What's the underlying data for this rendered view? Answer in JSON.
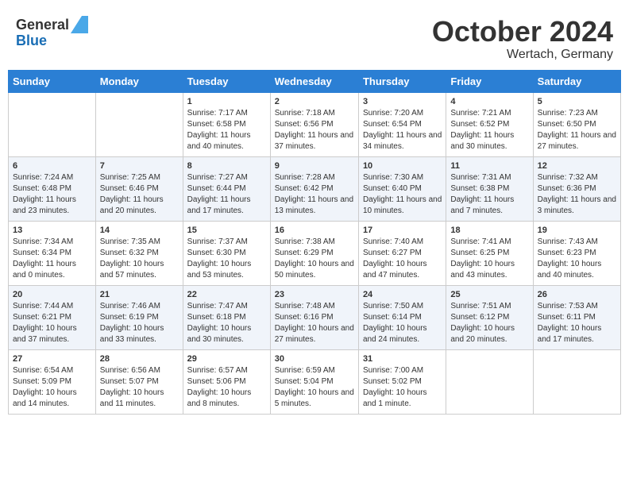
{
  "header": {
    "logo_general": "General",
    "logo_blue": "Blue",
    "month": "October 2024",
    "location": "Wertach, Germany"
  },
  "weekdays": [
    "Sunday",
    "Monday",
    "Tuesday",
    "Wednesday",
    "Thursday",
    "Friday",
    "Saturday"
  ],
  "weeks": [
    [
      {
        "day": "",
        "info": ""
      },
      {
        "day": "",
        "info": ""
      },
      {
        "day": "1",
        "info": "Sunrise: 7:17 AM\nSunset: 6:58 PM\nDaylight: 11 hours and 40 minutes."
      },
      {
        "day": "2",
        "info": "Sunrise: 7:18 AM\nSunset: 6:56 PM\nDaylight: 11 hours and 37 minutes."
      },
      {
        "day": "3",
        "info": "Sunrise: 7:20 AM\nSunset: 6:54 PM\nDaylight: 11 hours and 34 minutes."
      },
      {
        "day": "4",
        "info": "Sunrise: 7:21 AM\nSunset: 6:52 PM\nDaylight: 11 hours and 30 minutes."
      },
      {
        "day": "5",
        "info": "Sunrise: 7:23 AM\nSunset: 6:50 PM\nDaylight: 11 hours and 27 minutes."
      }
    ],
    [
      {
        "day": "6",
        "info": "Sunrise: 7:24 AM\nSunset: 6:48 PM\nDaylight: 11 hours and 23 minutes."
      },
      {
        "day": "7",
        "info": "Sunrise: 7:25 AM\nSunset: 6:46 PM\nDaylight: 11 hours and 20 minutes."
      },
      {
        "day": "8",
        "info": "Sunrise: 7:27 AM\nSunset: 6:44 PM\nDaylight: 11 hours and 17 minutes."
      },
      {
        "day": "9",
        "info": "Sunrise: 7:28 AM\nSunset: 6:42 PM\nDaylight: 11 hours and 13 minutes."
      },
      {
        "day": "10",
        "info": "Sunrise: 7:30 AM\nSunset: 6:40 PM\nDaylight: 11 hours and 10 minutes."
      },
      {
        "day": "11",
        "info": "Sunrise: 7:31 AM\nSunset: 6:38 PM\nDaylight: 11 hours and 7 minutes."
      },
      {
        "day": "12",
        "info": "Sunrise: 7:32 AM\nSunset: 6:36 PM\nDaylight: 11 hours and 3 minutes."
      }
    ],
    [
      {
        "day": "13",
        "info": "Sunrise: 7:34 AM\nSunset: 6:34 PM\nDaylight: 11 hours and 0 minutes."
      },
      {
        "day": "14",
        "info": "Sunrise: 7:35 AM\nSunset: 6:32 PM\nDaylight: 10 hours and 57 minutes."
      },
      {
        "day": "15",
        "info": "Sunrise: 7:37 AM\nSunset: 6:30 PM\nDaylight: 10 hours and 53 minutes."
      },
      {
        "day": "16",
        "info": "Sunrise: 7:38 AM\nSunset: 6:29 PM\nDaylight: 10 hours and 50 minutes."
      },
      {
        "day": "17",
        "info": "Sunrise: 7:40 AM\nSunset: 6:27 PM\nDaylight: 10 hours and 47 minutes."
      },
      {
        "day": "18",
        "info": "Sunrise: 7:41 AM\nSunset: 6:25 PM\nDaylight: 10 hours and 43 minutes."
      },
      {
        "day": "19",
        "info": "Sunrise: 7:43 AM\nSunset: 6:23 PM\nDaylight: 10 hours and 40 minutes."
      }
    ],
    [
      {
        "day": "20",
        "info": "Sunrise: 7:44 AM\nSunset: 6:21 PM\nDaylight: 10 hours and 37 minutes."
      },
      {
        "day": "21",
        "info": "Sunrise: 7:46 AM\nSunset: 6:19 PM\nDaylight: 10 hours and 33 minutes."
      },
      {
        "day": "22",
        "info": "Sunrise: 7:47 AM\nSunset: 6:18 PM\nDaylight: 10 hours and 30 minutes."
      },
      {
        "day": "23",
        "info": "Sunrise: 7:48 AM\nSunset: 6:16 PM\nDaylight: 10 hours and 27 minutes."
      },
      {
        "day": "24",
        "info": "Sunrise: 7:50 AM\nSunset: 6:14 PM\nDaylight: 10 hours and 24 minutes."
      },
      {
        "day": "25",
        "info": "Sunrise: 7:51 AM\nSunset: 6:12 PM\nDaylight: 10 hours and 20 minutes."
      },
      {
        "day": "26",
        "info": "Sunrise: 7:53 AM\nSunset: 6:11 PM\nDaylight: 10 hours and 17 minutes."
      }
    ],
    [
      {
        "day": "27",
        "info": "Sunrise: 6:54 AM\nSunset: 5:09 PM\nDaylight: 10 hours and 14 minutes."
      },
      {
        "day": "28",
        "info": "Sunrise: 6:56 AM\nSunset: 5:07 PM\nDaylight: 10 hours and 11 minutes."
      },
      {
        "day": "29",
        "info": "Sunrise: 6:57 AM\nSunset: 5:06 PM\nDaylight: 10 hours and 8 minutes."
      },
      {
        "day": "30",
        "info": "Sunrise: 6:59 AM\nSunset: 5:04 PM\nDaylight: 10 hours and 5 minutes."
      },
      {
        "day": "31",
        "info": "Sunrise: 7:00 AM\nSunset: 5:02 PM\nDaylight: 10 hours and 1 minute."
      },
      {
        "day": "",
        "info": ""
      },
      {
        "day": "",
        "info": ""
      }
    ]
  ]
}
